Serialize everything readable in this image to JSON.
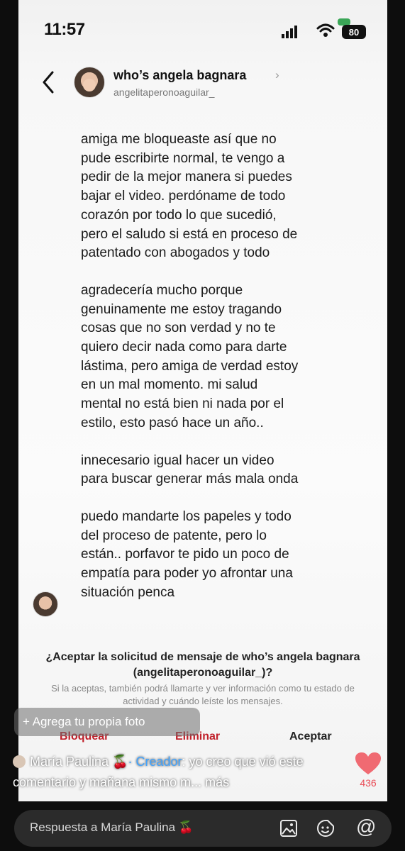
{
  "status_bar": {
    "time": "11:57",
    "battery": "80"
  },
  "header": {
    "name": "who’s angela bagnara",
    "username": "angelitaperonoaguilar_",
    "chevron": "›"
  },
  "message": {
    "paragraphs": [
      "amiga me bloqueaste así que no\npude escribirte normal, te vengo a\npedir de la mejor manera si puedes\nbajar el video. perdóname de todo\ncorazón por todo lo que sucedió,\npero el saludo si está en proceso de\npatentado con abogados y todo",
      "agradecería mucho porque\ngenuinamente me estoy tragando\ncosas que no son verdad y no te\nquiero decir nada como para darte\nlástima, pero amiga de verdad estoy\nen un mal momento. mi salud\nmental no está bien ni nada por el\nestilo, esto pasó hace un año..",
      "innecesario igual hacer un video\npara buscar generar más mala onda",
      "puedo mandarte los papeles y todo\ndel proceso de patente, pero lo\nestán.. porfavor te pido un poco de\nempatía para poder yo afrontar una\nsituación penca"
    ]
  },
  "request": {
    "title": "¿Aceptar la solicitud de mensaje de who’s angela bagnara (angelitaperonoaguilar_)?",
    "subtitle": "Si la aceptas, también podrá llamarte y ver información como tu estado de actividad y cuándo leíste los mensajes.",
    "block_label": "Bloquear",
    "delete_label": "Eliminar",
    "accept_label": "Aceptar"
  },
  "overlay": {
    "add_photo": "+ Agrega tu propia foto",
    "comment_author": "María Paulina",
    "comment_cherry": "🍒",
    "comment_badge": "· Creador",
    "comment_text": ": yo creo que vió este comentario y mañana mismo m...",
    "comment_more": "más",
    "likes": "436"
  },
  "reply_bar": {
    "placeholder": "Respuesta a María Paulina 🍒",
    "mention": "@"
  }
}
